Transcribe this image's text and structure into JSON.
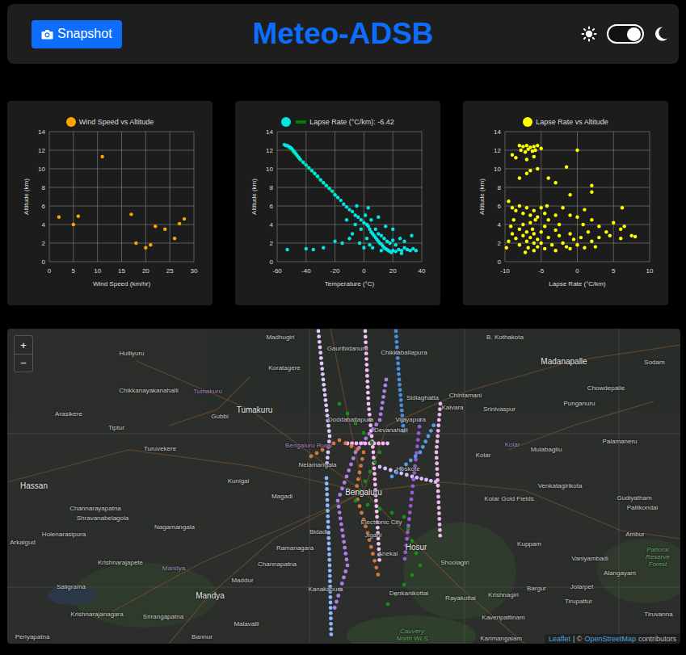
{
  "header": {
    "snapshot_button": "Snapshot",
    "title": "Meteo-ADSB",
    "dark_mode": true
  },
  "charts": [
    {
      "legend": "Wind Speed vs Altitude",
      "color": "#ffa500",
      "x_title": "Wind Speed (km/hr)",
      "y_title": "Altitude (km)",
      "x_ticks": [
        "0",
        "5",
        "10",
        "15",
        "20",
        "25",
        "30"
      ],
      "y_ticks": [
        "0",
        "2",
        "4",
        "6",
        "8",
        "10",
        "12",
        "14"
      ],
      "points": [
        [
          2,
          4.8
        ],
        [
          5,
          4.0
        ],
        [
          6,
          4.9
        ],
        [
          11,
          11.3
        ],
        [
          17,
          5.1
        ],
        [
          18,
          2.0
        ],
        [
          20,
          1.5
        ],
        [
          21,
          1.8
        ],
        [
          22,
          3.8
        ],
        [
          24,
          3.5
        ],
        [
          26,
          2.5
        ],
        [
          27,
          4.1
        ],
        [
          28,
          4.6
        ]
      ]
    },
    {
      "legend": "Lapse Rate (°C/km): -6.42",
      "color": "#00e5e5",
      "x_title": "Temperature (°C)",
      "y_title": "Altitude (km)",
      "x_ticks": [
        "-60",
        "-40",
        "-20",
        "0",
        "20",
        "40"
      ],
      "y_ticks": [
        "0",
        "2",
        "4",
        "6",
        "8",
        "10",
        "12",
        "14"
      ],
      "fit": {
        "color": "#008000",
        "points": [
          [
            -53,
            12.4
          ],
          [
            -18,
            6.9
          ]
        ]
      },
      "points": [
        [
          -55,
          12.6
        ],
        [
          -54,
          12.5
        ],
        [
          -53,
          12.5
        ],
        [
          -52,
          12.4
        ],
        [
          -51,
          12.3
        ],
        [
          -50,
          12.2
        ],
        [
          -49,
          12.0
        ],
        [
          -48,
          11.8
        ],
        [
          -47,
          11.6
        ],
        [
          -46,
          11.4
        ],
        [
          -45,
          11.2
        ],
        [
          -44,
          11.0
        ],
        [
          -42,
          10.7
        ],
        [
          -40,
          10.4
        ],
        [
          -38,
          10.1
        ],
        [
          -36,
          9.8
        ],
        [
          -34,
          9.5
        ],
        [
          -32,
          9.2
        ],
        [
          -30,
          8.8
        ],
        [
          -28,
          8.5
        ],
        [
          -26,
          8.2
        ],
        [
          -24,
          7.9
        ],
        [
          -22,
          7.6
        ],
        [
          -20,
          7.2
        ],
        [
          -18,
          6.9
        ],
        [
          -16,
          6.6
        ],
        [
          -14,
          6.2
        ],
        [
          -12,
          5.9
        ],
        [
          -10,
          5.6
        ],
        [
          -8,
          5.4
        ],
        [
          -6,
          5.0
        ],
        [
          -4,
          4.8
        ],
        [
          -2,
          4.5
        ],
        [
          0,
          4.2
        ],
        [
          2,
          4.0
        ],
        [
          1,
          5.0
        ],
        [
          3,
          3.8
        ],
        [
          4,
          3.5
        ],
        [
          5,
          3.2
        ],
        [
          6,
          3.0
        ],
        [
          7,
          2.8
        ],
        [
          8,
          2.6
        ],
        [
          9,
          2.4
        ],
        [
          10,
          2.2
        ],
        [
          11,
          2.0
        ],
        [
          12,
          1.9
        ],
        [
          13,
          1.7
        ],
        [
          14,
          1.5
        ],
        [
          15,
          1.4
        ],
        [
          16,
          1.3
        ],
        [
          17,
          1.2
        ],
        [
          18,
          1.1
        ],
        [
          19,
          1.0
        ],
        [
          20,
          1.2
        ],
        [
          22,
          1.1
        ],
        [
          24,
          1.3
        ],
        [
          26,
          1.2
        ],
        [
          28,
          1.5
        ],
        [
          30,
          1.3
        ],
        [
          32,
          1.2
        ],
        [
          34,
          1.4
        ],
        [
          36,
          1.2
        ],
        [
          2,
          2.5
        ],
        [
          4,
          1.8
        ],
        [
          6,
          1.5
        ],
        [
          8,
          3.5
        ],
        [
          10,
          3.0
        ],
        [
          12,
          2.8
        ],
        [
          14,
          2.5
        ],
        [
          16,
          2.2
        ],
        [
          18,
          2.0
        ],
        [
          20,
          2.3
        ],
        [
          22,
          1.8
        ],
        [
          25,
          2.5
        ],
        [
          28,
          2.2
        ],
        [
          5,
          4.5
        ],
        [
          -5,
          6.0
        ],
        [
          -8,
          3.0
        ],
        [
          -3,
          2.0
        ],
        [
          0,
          1.5
        ],
        [
          -10,
          2.5
        ],
        [
          -15,
          2.0
        ],
        [
          -20,
          2.2
        ],
        [
          -28,
          1.5
        ],
        [
          -40,
          1.4
        ],
        [
          -53,
          1.3
        ],
        [
          -35,
          1.3
        ],
        [
          -12,
          4.5
        ],
        [
          33,
          2.8
        ],
        [
          20,
          3.5
        ],
        [
          15,
          3.8
        ],
        [
          10,
          4.8
        ],
        [
          -2,
          3.5
        ],
        [
          3,
          5.8
        ],
        [
          -6,
          4.0
        ],
        [
          12,
          1.2
        ],
        [
          26,
          0.9
        ]
      ]
    },
    {
      "legend": "Lapse Rate vs Altitude",
      "color": "#ffff00",
      "x_title": "Lapse Rate (°C/km)",
      "y_title": "Altitude (km)",
      "x_ticks": [
        "-10",
        "-5",
        "0",
        "5",
        "10"
      ],
      "y_ticks": [
        "0",
        "2",
        "4",
        "6",
        "8",
        "10",
        "12",
        "14"
      ],
      "points": [
        [
          -8,
          12.5
        ],
        [
          -7.5,
          12.4
        ],
        [
          -7,
          12.5
        ],
        [
          -6.5,
          12.3
        ],
        [
          -6,
          12.4
        ],
        [
          -5.5,
          12.5
        ],
        [
          -5,
          12.2
        ],
        [
          -7.8,
          12.0
        ],
        [
          -7.2,
          11.8
        ],
        [
          -6.8,
          12.1
        ],
        [
          -6.2,
          11.9
        ],
        [
          -5.8,
          12.0
        ],
        [
          -9,
          11.5
        ],
        [
          -8.5,
          11.2
        ],
        [
          -7,
          11.0
        ],
        [
          -6,
          11.3
        ],
        [
          -5.5,
          10.0
        ],
        [
          -6.5,
          9.8
        ],
        [
          -7,
          9.5
        ],
        [
          -8,
          9.0
        ],
        [
          -4,
          9.0
        ],
        [
          -3,
          8.5
        ],
        [
          -1,
          7.2
        ],
        [
          0,
          12.0
        ],
        [
          -1.5,
          10.2
        ],
        [
          2,
          8.2
        ],
        [
          2,
          7.5
        ],
        [
          -9.5,
          6.5
        ],
        [
          -9,
          5.8
        ],
        [
          -8.5,
          5.5
        ],
        [
          -8,
          6.0
        ],
        [
          -7.5,
          5.2
        ],
        [
          -7,
          5.8
        ],
        [
          -6.5,
          5.0
        ],
        [
          -6,
          5.5
        ],
        [
          -5.5,
          4.8
        ],
        [
          -5,
          5.8
        ],
        [
          -4.5,
          5.2
        ],
        [
          -4,
          4.5
        ],
        [
          -3,
          5.0
        ],
        [
          -2,
          5.8
        ],
        [
          -1,
          5.0
        ],
        [
          0,
          4.8
        ],
        [
          1,
          5.6
        ],
        [
          2,
          4.5
        ],
        [
          3,
          3.8
        ],
        [
          4,
          3.2
        ],
        [
          5,
          4.2
        ],
        [
          6,
          3.5
        ],
        [
          6.2,
          5.8
        ],
        [
          6.5,
          3.8
        ],
        [
          7.5,
          2.8
        ],
        [
          8,
          2.7
        ],
        [
          6,
          2.5
        ],
        [
          4.5,
          2.8
        ],
        [
          -9.8,
          1.5
        ],
        [
          -9.5,
          2.2
        ],
        [
          -9,
          3.0
        ],
        [
          -8.5,
          2.5
        ],
        [
          -8,
          1.8
        ],
        [
          -8,
          3.5
        ],
        [
          -7.5,
          2.8
        ],
        [
          -7.5,
          4.0
        ],
        [
          -7,
          2.2
        ],
        [
          -7,
          3.2
        ],
        [
          -6.8,
          1.5
        ],
        [
          -6.5,
          2.6
        ],
        [
          -6.5,
          4.2
        ],
        [
          -6.2,
          3.5
        ],
        [
          -6,
          1.2
        ],
        [
          -6,
          2.0
        ],
        [
          -6,
          3.0
        ],
        [
          -5.8,
          4.5
        ],
        [
          -5.5,
          2.4
        ],
        [
          -5.5,
          1.6
        ],
        [
          -5,
          3.2
        ],
        [
          -5,
          2.0
        ],
        [
          -4.5,
          1.4
        ],
        [
          -4.5,
          3.8
        ],
        [
          -4,
          2.6
        ],
        [
          -3.5,
          1.8
        ],
        [
          -3,
          3.4
        ],
        [
          -3,
          1.2
        ],
        [
          -2.5,
          2.8
        ],
        [
          -2,
          2.0
        ],
        [
          -1.5,
          1.6
        ],
        [
          -1,
          3.0
        ],
        [
          -1,
          1.4
        ],
        [
          -0.5,
          2.4
        ],
        [
          0,
          1.8
        ],
        [
          0.5,
          2.6
        ],
        [
          1,
          1.5
        ],
        [
          1.5,
          3.2
        ],
        [
          2,
          2.2
        ],
        [
          2.5,
          1.6
        ],
        [
          3,
          2.6
        ],
        [
          -8.8,
          4.5
        ],
        [
          -9.2,
          3.8
        ],
        [
          -7.2,
          1.0
        ],
        [
          -4.2,
          6.0
        ],
        [
          -2.5,
          4.0
        ],
        [
          0.8,
          4.0
        ]
      ]
    }
  ],
  "map": {
    "zoom_in": "+",
    "zoom_out": "−",
    "labels": [
      {
        "name": "Madhugiri",
        "kind": "town"
      },
      {
        "name": "B. Kothakota",
        "kind": "town"
      },
      {
        "name": "Madanapalle",
        "kind": "city"
      },
      {
        "name": "Hulliyuru",
        "kind": "town"
      },
      {
        "name": "Gauribidanuru",
        "kind": "town"
      },
      {
        "name": "Chikkaballapura",
        "kind": "town"
      },
      {
        "name": "Koratagere",
        "kind": "town"
      },
      {
        "name": "Sodam",
        "kind": "town"
      },
      {
        "name": "Chikkanayakanahalli",
        "kind": "town"
      },
      {
        "name": "Tumakuru",
        "kind": "district"
      },
      {
        "name": "Chowdepalle",
        "kind": "town"
      },
      {
        "name": "Chintamani",
        "kind": "town"
      },
      {
        "name": "Sidlaghatta",
        "kind": "town"
      },
      {
        "name": "Punganuru",
        "kind": "town"
      },
      {
        "name": "Arasikere",
        "kind": "town"
      },
      {
        "name": "Tumakuru",
        "kind": "city"
      },
      {
        "name": "Gubbi",
        "kind": "town"
      },
      {
        "name": "Kaivara",
        "kind": "town"
      },
      {
        "name": "Srinivaspur",
        "kind": "town"
      },
      {
        "name": "Doddaballapura",
        "kind": "town"
      },
      {
        "name": "Vijayapura",
        "kind": "town"
      },
      {
        "name": "Tiptur",
        "kind": "town"
      },
      {
        "name": "Devanahalli",
        "kind": "town"
      },
      {
        "name": "Turuvekere",
        "kind": "town"
      },
      {
        "name": "Bengaluru Rural",
        "kind": "district"
      },
      {
        "name": "Kolar",
        "kind": "district"
      },
      {
        "name": "Mulabagilu",
        "kind": "town"
      },
      {
        "name": "Palamaneru",
        "kind": "town"
      },
      {
        "name": "Kolar",
        "kind": "town"
      },
      {
        "name": "Nelamangala",
        "kind": "town"
      },
      {
        "name": "Hoskote",
        "kind": "town"
      },
      {
        "name": "Hassan",
        "kind": "city"
      },
      {
        "name": "Kunigal",
        "kind": "town"
      },
      {
        "name": "Bengaluru",
        "kind": "city"
      },
      {
        "name": "Venkatagirikota",
        "kind": "town"
      },
      {
        "name": "Kolar Gold Fields",
        "kind": "town"
      },
      {
        "name": "Gudiyatham",
        "kind": "town"
      },
      {
        "name": "Channarayapatna",
        "kind": "town"
      },
      {
        "name": "Magadi",
        "kind": "town"
      },
      {
        "name": "Pallikondai",
        "kind": "town"
      },
      {
        "name": "Shravanabelagola",
        "kind": "town"
      },
      {
        "name": "Electronic City",
        "kind": "town"
      },
      {
        "name": "Nagamangala",
        "kind": "town"
      },
      {
        "name": "Bidadi",
        "kind": "town"
      },
      {
        "name": "Jigani",
        "kind": "town"
      },
      {
        "name": "Holenarasipura",
        "kind": "town"
      },
      {
        "name": "Arkalgud",
        "kind": "town"
      },
      {
        "name": "Ambur",
        "kind": "town"
      },
      {
        "name": "Hosur",
        "kind": "city"
      },
      {
        "name": "Ramanagara",
        "kind": "town"
      },
      {
        "name": "Kuppam",
        "kind": "town"
      },
      {
        "name": "Anekal",
        "kind": "town"
      },
      {
        "name": "Vaniyambadi",
        "kind": "town"
      },
      {
        "name": "Shoolagiri",
        "kind": "town"
      },
      {
        "name": "Krishnarajapete",
        "kind": "town"
      },
      {
        "name": "Channapatna",
        "kind": "town"
      },
      {
        "name": "Mandya",
        "kind": "district"
      },
      {
        "name": "Pattorai Reserve Forest",
        "kind": "park"
      },
      {
        "name": "Alangayam",
        "kind": "town"
      },
      {
        "name": "Maddur",
        "kind": "town"
      },
      {
        "name": "Saligrama",
        "kind": "town"
      },
      {
        "name": "Bargur",
        "kind": "town"
      },
      {
        "name": "Jolarpet",
        "kind": "town"
      },
      {
        "name": "Kanakapura",
        "kind": "town"
      },
      {
        "name": "Mandya",
        "kind": "city"
      },
      {
        "name": "Denkanikottai",
        "kind": "town"
      },
      {
        "name": "Rayakottai",
        "kind": "town"
      },
      {
        "name": "Krishnagiri",
        "kind": "town"
      },
      {
        "name": "Tirupattur",
        "kind": "town"
      },
      {
        "name": "Krishnarajanagara",
        "kind": "town"
      },
      {
        "name": "Srirangapatna",
        "kind": "town"
      },
      {
        "name": "Kaveripattinam",
        "kind": "town"
      },
      {
        "name": "Tiruvanna",
        "kind": "town"
      },
      {
        "name": "Malavalli",
        "kind": "town"
      },
      {
        "name": "Periyapatna",
        "kind": "town"
      },
      {
        "name": "Bannur",
        "kind": "town"
      },
      {
        "name": "Cauvery North WLS",
        "kind": "park"
      },
      {
        "name": "Karimangalam",
        "kind": "town"
      }
    ],
    "tracks": [
      {
        "color": "#e0c8ff"
      },
      {
        "color": "#8fb8ff"
      },
      {
        "color": "#f5c0f5"
      },
      {
        "color": "#4a8fe0"
      },
      {
        "color": "#b07ee8"
      },
      {
        "color": "#ffb3ff"
      },
      {
        "color": "#f0b8f0"
      },
      {
        "color": "#d8c0ff"
      },
      {
        "color": "#d2783c"
      },
      {
        "color": "#1a8a1a"
      },
      {
        "color": "#9a5ad8"
      },
      {
        "color": "#5a9ae8"
      }
    ],
    "attribution": {
      "leaflet": "Leaflet",
      "separator": "| ©",
      "osm": "OpenStreetMap",
      "suffix": "contributors"
    }
  }
}
